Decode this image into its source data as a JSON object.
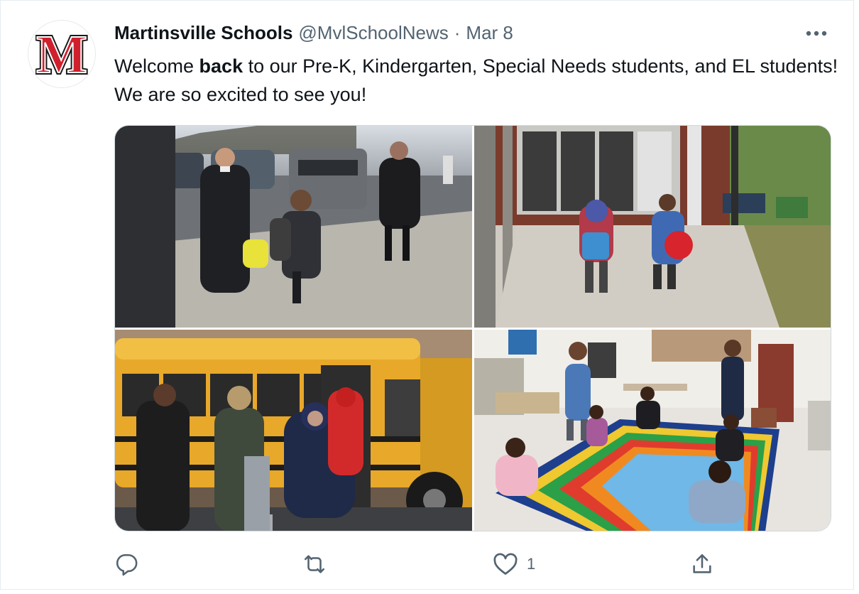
{
  "tweet": {
    "author_name": "Martinsville Schools",
    "handle": "@MvlSchoolNews",
    "separator": "·",
    "date": "Mar 8",
    "text_before": "Welcome ",
    "text_bold": "back",
    "text_after": " to our Pre-K, Kindergarten, Special Needs students, and EL students! We are so excited to see you!",
    "logo_letter": "M",
    "more_icon": "more-horizontal-icon"
  },
  "media": {
    "photos": [
      {
        "name": "photo-parking-lot",
        "description_icon": "photo"
      },
      {
        "name": "photo-school-entrance",
        "description_icon": "photo"
      },
      {
        "name": "photo-school-bus",
        "description_icon": "photo"
      },
      {
        "name": "photo-classroom-rug",
        "description_icon": "photo"
      }
    ]
  },
  "actions": {
    "reply_icon": "reply-icon",
    "retweet_icon": "retweet-icon",
    "like_icon": "like-icon",
    "like_count": "1",
    "share_icon": "share-icon"
  },
  "colors": {
    "brand_red": "#d0202e",
    "icon_gray": "#536471",
    "border": "#cfd9de"
  }
}
